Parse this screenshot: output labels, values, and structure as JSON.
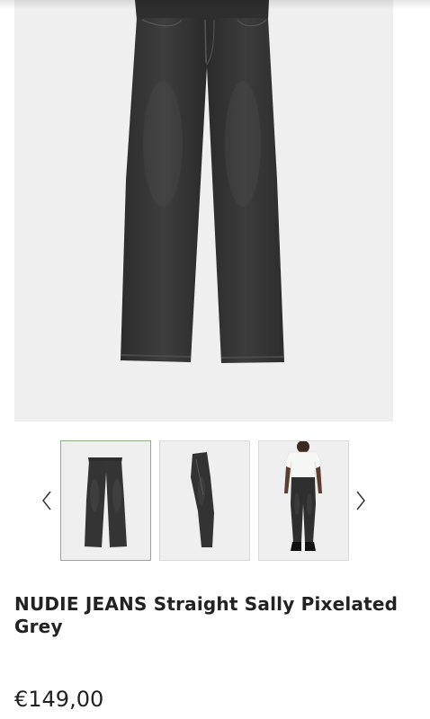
{
  "product": {
    "title": "NUDIE JEANS Straight Sally Pixelated Grey",
    "price": "€149,00"
  },
  "main_image": {
    "alt": "Front view of grey straight jeans"
  },
  "gallery": {
    "thumbnails": [
      {
        "alt": "Front view of jeans",
        "selected": true
      },
      {
        "alt": "Side view of jeans",
        "selected": false
      },
      {
        "alt": "Model wearing jeans",
        "selected": false
      }
    ],
    "prev_icon": "chevron-left-icon",
    "next_icon": "chevron-right-icon"
  },
  "colors": {
    "denim": "#333333",
    "background": "#efefef",
    "selected_border": "#8fae86",
    "text": "#222222"
  }
}
